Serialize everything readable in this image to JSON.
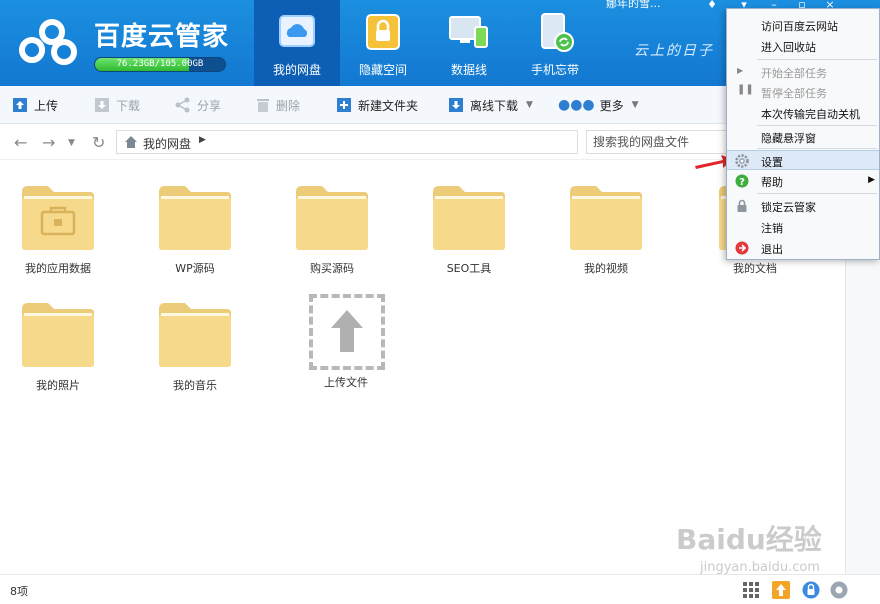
{
  "app": {
    "title": "百度云管家",
    "quota_text": "76.23GB/105.00GB",
    "quota_fraction": 0.726,
    "slogan": "云上的日子",
    "user": "娜年的雪..."
  },
  "nav_tabs": [
    {
      "label": "我的网盘",
      "active": true
    },
    {
      "label": "隐藏空间",
      "active": false
    },
    {
      "label": "数据线",
      "active": false
    },
    {
      "label": "手机忘带",
      "active": false
    }
  ],
  "toolbar": {
    "upload": "上传",
    "download": "下载",
    "share": "分享",
    "delete": "删除",
    "new_folder": "新建文件夹",
    "offline_download": "离线下载",
    "more": "更多"
  },
  "address": {
    "path": "我的网盘",
    "search_placeholder": "搜索我的网盘文件"
  },
  "files": [
    {
      "name": "我的应用数据",
      "icon": "briefcase-folder"
    },
    {
      "name": "WP源码",
      "icon": "folder"
    },
    {
      "name": "购买源码",
      "icon": "folder"
    },
    {
      "name": "SEO工具",
      "icon": "folder"
    },
    {
      "name": "我的视频",
      "icon": "folder"
    },
    {
      "name": "我的文档",
      "icon": "folder"
    },
    {
      "name": "我的照片",
      "icon": "folder"
    },
    {
      "name": "我的音乐",
      "icon": "folder"
    }
  ],
  "upload_tile": {
    "label": "上传文件"
  },
  "status": {
    "count": "8项"
  },
  "menu": {
    "items": [
      {
        "label": "访问百度云网站",
        "icon": "",
        "disabled": false
      },
      {
        "label": "进入回收站",
        "icon": "",
        "disabled": false
      },
      {
        "label": "开始全部任务",
        "icon": "play-icon",
        "disabled": true
      },
      {
        "label": "暂停全部任务",
        "icon": "pause-icon",
        "disabled": true
      },
      {
        "label": "本次传输完自动关机",
        "icon": "",
        "disabled": false
      },
      {
        "label": "隐藏悬浮窗",
        "icon": "",
        "disabled": false
      },
      {
        "label": "设置",
        "icon": "gear-icon",
        "disabled": false
      },
      {
        "label": "帮助",
        "icon": "help-icon",
        "disabled": false
      },
      {
        "label": "锁定云管家",
        "icon": "lock-icon",
        "disabled": false
      },
      {
        "label": "注销",
        "icon": "",
        "disabled": false
      },
      {
        "label": "退出",
        "icon": "exit-icon",
        "disabled": false
      }
    ]
  },
  "watermark": {
    "text": "Baidu经验",
    "sub": "jingyan.baidu.com"
  },
  "colors": {
    "header": "#1483d8",
    "active_tab": "#0c5fb5",
    "folder": "#f7d98b",
    "menu_hover": "#dde9f6"
  }
}
